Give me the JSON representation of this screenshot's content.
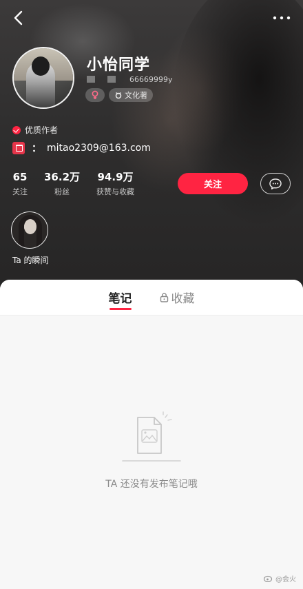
{
  "profile": {
    "name": "小怡同学",
    "id_suffix": "66669999y",
    "zodiac_tag": "文化著",
    "quality_badge": "优质作者",
    "email_colon": "：",
    "email": "mitao2309@163.com"
  },
  "stats": [
    {
      "value": "65",
      "label": "关注"
    },
    {
      "value": "36.2万",
      "label": "粉丝"
    },
    {
      "value": "94.9万",
      "label": "获赞与收藏"
    }
  ],
  "actions": {
    "follow_label": "关注"
  },
  "moment": {
    "label": "Ta 的瞬间"
  },
  "tabs": [
    {
      "label": "笔记",
      "active": true
    },
    {
      "label": "收藏",
      "active": false,
      "locked": true
    }
  ],
  "empty_state": {
    "text": "TA 还没有发布笔记哦"
  },
  "watermark": {
    "text": "@会火"
  },
  "colors": {
    "accent": "#ff2442",
    "header_bg": "#2f2e2e"
  }
}
